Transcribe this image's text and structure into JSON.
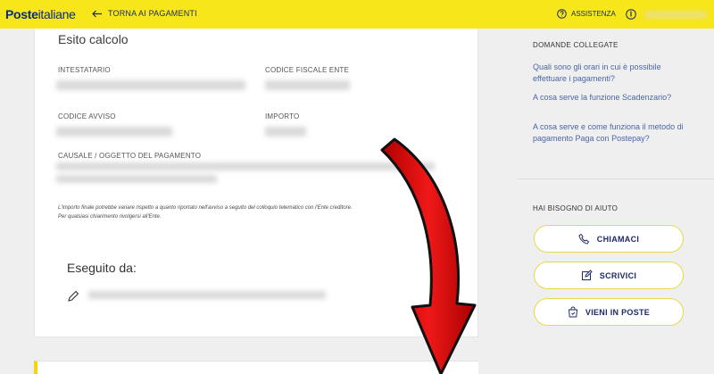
{
  "header": {
    "logo_bold": "Poste",
    "logo_regular": "italiane",
    "back_label": "TORNA AI PAGAMENTI",
    "assistance_label": "ASSISTENZA",
    "accent_color": "#f6e61a"
  },
  "main": {
    "title": "Esito calcolo",
    "labels": {
      "holder": "INTESTATARIO",
      "tax_code": "CODICE FISCALE ENTE",
      "notice_code": "CODICE AVVISO",
      "amount": "IMPORTO",
      "reason": "CAUSALE / OGGETTO DEL PAGAMENTO"
    },
    "note_line1": "L'importo finale potrebbe variare rispetto a quanto riportato nell'avviso a seguito del colloquio telematico con l'Ente creditore.",
    "note_line2": "Per qualsiasi chiarimento rivolgersi all'Ente.",
    "executed_by": "Eseguito da:"
  },
  "sidebar": {
    "related_heading": "DOMANDE COLLEGATE",
    "links": [
      "Quali sono gli orari in cui è possibile effettuare i pagamenti?",
      "A cosa serve la funzione Scadenzario?",
      "A cosa serve e come funziona il metodo di pagamento Paga con Postepay?"
    ],
    "help_heading": "HAI BISOGNO DI AIUTO",
    "buttons": {
      "call": "CHIAMACI",
      "write": "SCRIVICI",
      "visit": "VIENI IN POSTE"
    }
  },
  "overlay": {
    "arrow_color": "#e01010",
    "arrow_icon": "red-curved-arrow"
  }
}
